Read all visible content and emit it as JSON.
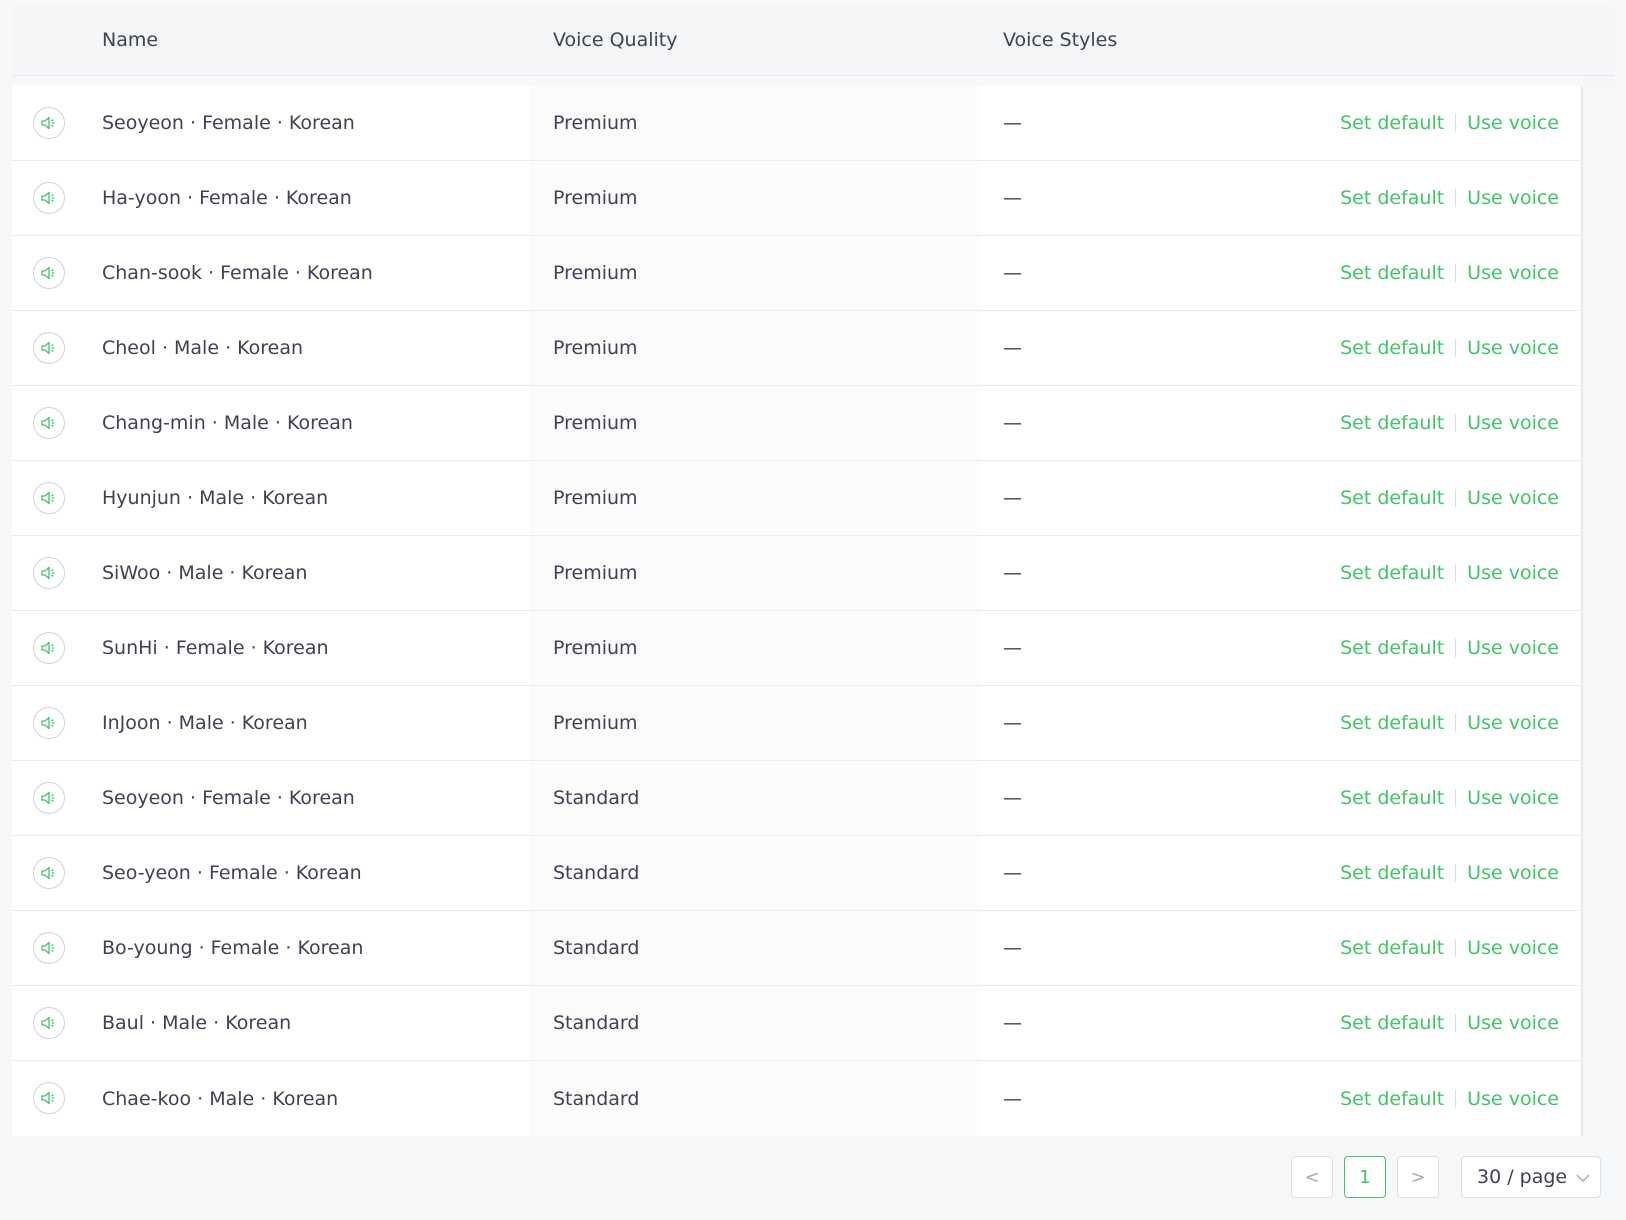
{
  "header": {
    "col_name": "Name",
    "col_quality": "Voice Quality",
    "col_styles": "Voice Styles"
  },
  "rows": [
    {
      "name": "Seoyeon · Female · Korean",
      "quality": "Premium",
      "styles": "—"
    },
    {
      "name": "Ha-yoon · Female · Korean",
      "quality": "Premium",
      "styles": "—"
    },
    {
      "name": "Chan-sook · Female · Korean",
      "quality": "Premium",
      "styles": "—"
    },
    {
      "name": "Cheol · Male · Korean",
      "quality": "Premium",
      "styles": "—"
    },
    {
      "name": "Chang-min · Male · Korean",
      "quality": "Premium",
      "styles": "—"
    },
    {
      "name": "Hyunjun · Male · Korean",
      "quality": "Premium",
      "styles": "—"
    },
    {
      "name": "SiWoo · Male · Korean",
      "quality": "Premium",
      "styles": "—"
    },
    {
      "name": "SunHi · Female · Korean",
      "quality": "Premium",
      "styles": "—"
    },
    {
      "name": "InJoon · Male · Korean",
      "quality": "Premium",
      "styles": "—"
    },
    {
      "name": "Seoyeon · Female · Korean",
      "quality": "Standard",
      "styles": "—"
    },
    {
      "name": "Seo-yeon · Female · Korean",
      "quality": "Standard",
      "styles": "—"
    },
    {
      "name": "Bo-young · Female · Korean",
      "quality": "Standard",
      "styles": "—"
    },
    {
      "name": "Baul · Male · Korean",
      "quality": "Standard",
      "styles": "—"
    },
    {
      "name": "Chae-koo · Male · Korean",
      "quality": "Standard",
      "styles": "—"
    }
  ],
  "actions": {
    "set_default": "Set default",
    "use_voice": "Use voice"
  },
  "pagination": {
    "prev": "<",
    "current_page": "1",
    "next": ">",
    "page_size": "30 / page"
  },
  "icons": {
    "row_play": "speaker-icon",
    "page_size_dropdown": "chevron-down-icon"
  },
  "colors": {
    "accent": "#3fc765",
    "text": "#3f4254",
    "header_bg": "#f5f6f8"
  }
}
